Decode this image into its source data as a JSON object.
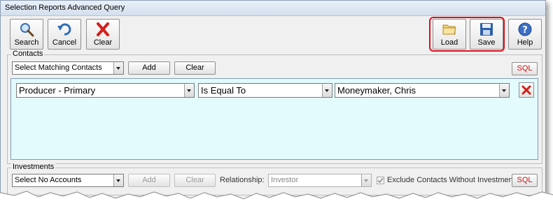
{
  "window": {
    "title": "Selection Reports Advanced Query"
  },
  "toolbar": {
    "search_label": "Search",
    "cancel_label": "Cancel",
    "clear_label": "Clear",
    "load_label": "Load",
    "save_label": "Save",
    "help_label": "Help"
  },
  "contacts": {
    "section_label": "Contacts",
    "match_select": "Select Matching Contacts",
    "add_label": "Add",
    "clear_label": "Clear",
    "sql_label": "SQL",
    "criteria": {
      "field": "Producer - Primary",
      "operator": "Is Equal To",
      "value": "Moneymaker, Chris"
    }
  },
  "investments": {
    "section_label": "Investments",
    "match_select": "Select No Accounts",
    "add_label": "Add",
    "clear_label": "Clear",
    "relationship_label": "Relationship:",
    "relationship_value": "Investor",
    "exclude_label": "Exclude Contacts Without Investments",
    "sql_label": "SQL"
  },
  "colors": {
    "highlight": "#e0101a",
    "criteria_bg": "#e3fbfd",
    "sql_text": "#d01010",
    "delete_icon": "#d4201a"
  }
}
